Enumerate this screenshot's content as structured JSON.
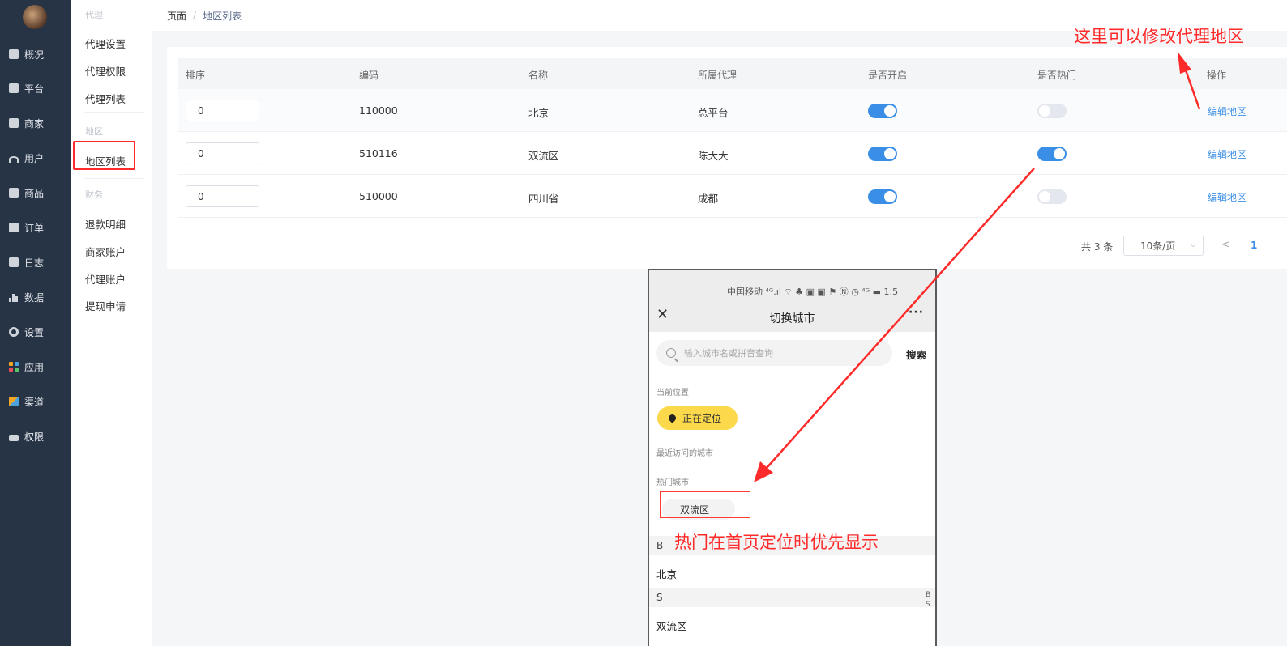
{
  "sidebar": {
    "items": [
      {
        "label": "概况",
        "icon": "dashboard-icon"
      },
      {
        "label": "平台",
        "icon": "monitor-icon"
      },
      {
        "label": "商家",
        "icon": "store-icon"
      },
      {
        "label": "用户",
        "icon": "user-icon"
      },
      {
        "label": "商品",
        "icon": "product-icon"
      },
      {
        "label": "订单",
        "icon": "order-icon"
      },
      {
        "label": "日志",
        "icon": "log-icon"
      },
      {
        "label": "数据",
        "icon": "chart-icon"
      },
      {
        "label": "设置",
        "icon": "gear-icon"
      },
      {
        "label": "应用",
        "icon": "apps-icon"
      },
      {
        "label": "渠道",
        "icon": "channel-icon"
      },
      {
        "label": "权限",
        "icon": "lock-icon"
      }
    ]
  },
  "submenu": {
    "groups": [
      {
        "title": "代理",
        "items": [
          "代理设置",
          "代理权限",
          "代理列表"
        ]
      },
      {
        "title": "地区",
        "items": [
          "地区列表"
        ]
      },
      {
        "title": "财务",
        "items": [
          "退款明细",
          "商家账户",
          "代理账户",
          "提现申请"
        ]
      }
    ]
  },
  "breadcrumb": {
    "root": "页面",
    "separator": "/",
    "current": "地区列表"
  },
  "table": {
    "headers": [
      "排序",
      "编码",
      "名称",
      "所属代理",
      "是否开启",
      "是否热门",
      "操作"
    ],
    "rows": [
      {
        "sort": "0",
        "code": "110000",
        "name": "北京",
        "agent": "总平台",
        "enabled": true,
        "hot": false,
        "action": "编辑地区"
      },
      {
        "sort": "0",
        "code": "510116",
        "name": "双流区",
        "agent": "陈大大",
        "enabled": true,
        "hot": true,
        "action": "编辑地区"
      },
      {
        "sort": "0",
        "code": "510000",
        "name": "四川省",
        "agent": "成都",
        "enabled": true,
        "hot": false,
        "action": "编辑地区"
      }
    ]
  },
  "pagination": {
    "total": "共 3 条",
    "page_size": "10条/页",
    "prev": "<",
    "current": "1"
  },
  "phone": {
    "status_bar": "中国移动 ⁴ᴳ.ıl ⌔ ♣ ▣ ▣ ⚑  Ⓝ ◷ ⁴ᴳ ▬ 1:5",
    "title": "切换城市",
    "close": "✕",
    "more": "···",
    "search_placeholder": "输入城市名或拼音查询",
    "search_button": "搜索",
    "current_location_label": "当前位置",
    "locating_button": "正在定位",
    "recent_label": "最近访问的城市",
    "hot_label": "热门城市",
    "hot_city": "双流区",
    "sections": [
      {
        "letter": "B",
        "city": "北京"
      },
      {
        "letter": "S",
        "city": "双流区"
      }
    ],
    "index_letters": [
      "B",
      "S"
    ]
  },
  "annotations": {
    "top_right": "这里可以修改代理地区",
    "hot_note": "热门在首页定位时优先显示",
    "color": "#ff2a2a"
  },
  "colors": {
    "primary": "#3a8ee6",
    "sidebar": "#263445",
    "toggle_off": "#e4e7ed",
    "locate_button": "#fcd94a"
  }
}
